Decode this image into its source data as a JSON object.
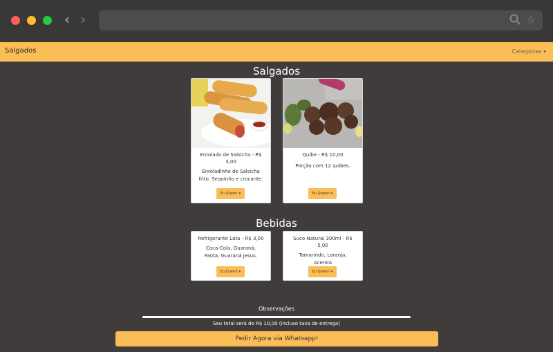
{
  "navbar": {
    "brand": "Salgados",
    "categories_label": "Categorias ▾"
  },
  "browser": {
    "back_icon": "‹",
    "forward_icon": "›",
    "search_icon": "🔍",
    "star_icon": "☆"
  },
  "sections": [
    {
      "title": "Salgados",
      "items": [
        {
          "title": "Enrolado de Salsicha - R$ 3,00",
          "description": "Enroladinho de Salsicha frito. Sequinho e crocante.",
          "button": "Eu Quero! ▾"
        },
        {
          "title": "Quibe - R$ 10,00",
          "description": "Porção com 12 quibes.",
          "button": "Eu Quero! ▾"
        }
      ]
    },
    {
      "title": "Bebidas",
      "items": [
        {
          "title": "Refrigerante Lata - R$ 3,00",
          "description": "Coca-Cola, Guaraná, Fanta, Guaraná Jesus.",
          "button": "Eu Quero! ▾"
        },
        {
          "title": "Suco Natural 300ml - R$ 5,00",
          "description": "Tamarindo, Laranja, Acerola",
          "button": "Eu Quero! ▾"
        }
      ]
    }
  ],
  "observations_label": "Observações",
  "total_text": "Seu total será de R$ 10,00 (incluso taxa de entrega)",
  "order_button": "Pedir Agora via Whatsapp!",
  "colors": {
    "accent": "#fbbd55",
    "background": "#3f3c3b"
  }
}
